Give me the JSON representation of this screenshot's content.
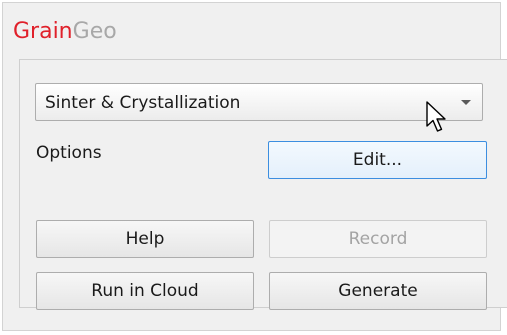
{
  "brand": {
    "part1": "Grain",
    "part2": "Geo",
    "accent_color": "#e0202a",
    "secondary_color": "#a8a8a8"
  },
  "process_select": {
    "value": "Sinter & Crystallization",
    "icon": "chevron-down-icon"
  },
  "options": {
    "label": "Options",
    "edit_button": "Edit..."
  },
  "buttons": {
    "help": "Help",
    "record": "Record",
    "run_in_cloud": "Run in Cloud",
    "generate": "Generate"
  },
  "states": {
    "record_enabled": false,
    "edit_hovered": true
  },
  "cursor": {
    "icon": "mouse-pointer-icon"
  }
}
